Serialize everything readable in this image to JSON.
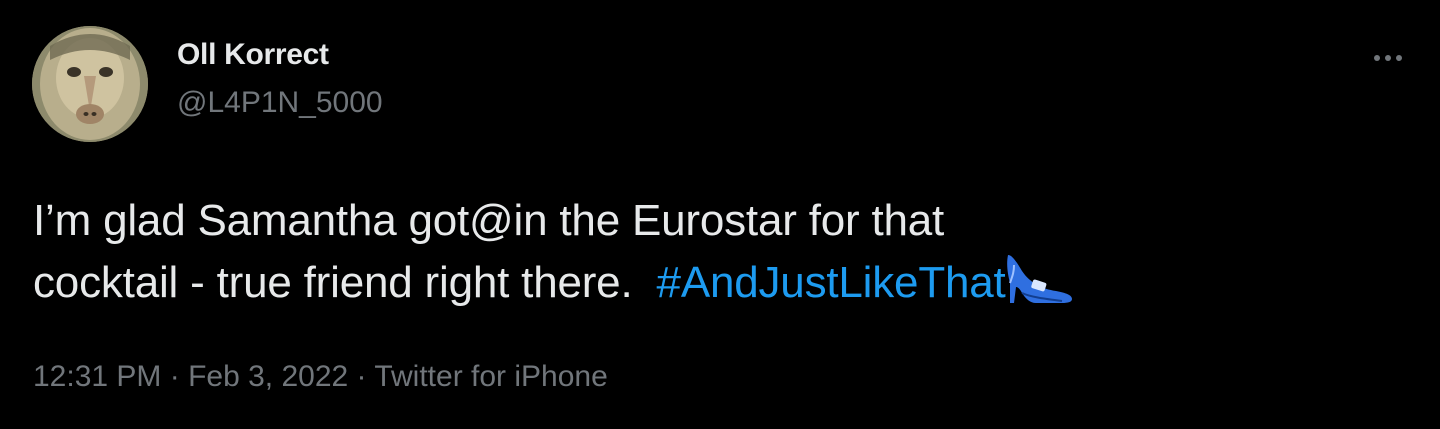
{
  "author": {
    "display_name": "Oll Korrect",
    "handle": "@L4P1N_5000",
    "avatar_icon": "monkey-avatar"
  },
  "tweet": {
    "line1": "I’m glad Samantha got@in the Eurostar for that",
    "line2_text": "cocktail - true friend right there.  ",
    "hashtag": "#AndJustLikeThat",
    "emoji_icon": "high-heel-shoe-icon"
  },
  "meta": {
    "time": "12:31 PM",
    "separator1": " · ",
    "date": "Feb 3, 2022",
    "separator2": " · ",
    "source": "Twitter for iPhone"
  },
  "more_icon": "more-options-icon",
  "colors": {
    "background": "#000000",
    "text": "#e7e9ea",
    "secondary": "#71767b",
    "link": "#1d9bf0"
  }
}
